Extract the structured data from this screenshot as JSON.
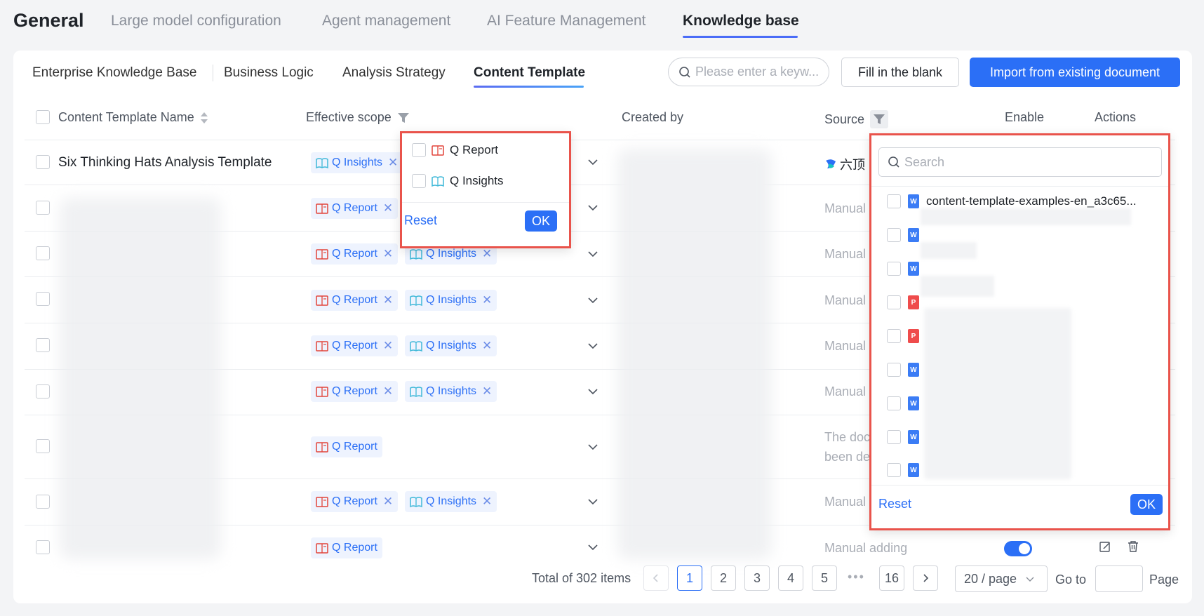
{
  "topnav": {
    "brand": "General",
    "tabs": [
      "Large model configuration",
      "Agent management",
      "AI Feature Management",
      "Knowledge base"
    ]
  },
  "subtabs": [
    "Enterprise Knowledge Base",
    "Business Logic",
    "Analysis Strategy",
    "Content Template"
  ],
  "toolbar": {
    "search_placeholder": "Please enter a keyw...",
    "fill_blank_label": "Fill in the blank",
    "import_label": "Import from existing document"
  },
  "table": {
    "headers": {
      "name": "Content Template Name",
      "scope": "Effective scope",
      "created_by": "Created by",
      "source": "Source",
      "enable": "Enable",
      "actions": "Actions"
    },
    "rows": [
      {
        "name": "Six Thinking Hats Analysis Template",
        "tags": [
          "Q Insights"
        ],
        "source": "六顶"
      },
      {
        "name": "",
        "tags": [
          "Q Report"
        ],
        "source": "Manual"
      },
      {
        "name": "",
        "tags": [
          "Q Report",
          "Q Insights"
        ],
        "source": "Manual"
      },
      {
        "name": "",
        "tags": [
          "Q Report",
          "Q Insights"
        ],
        "source": "Manual"
      },
      {
        "name": "",
        "tags": [
          "Q Report",
          "Q Insights"
        ],
        "source": "Manual"
      },
      {
        "name": "",
        "tags": [
          "Q Report",
          "Q Insights"
        ],
        "source": "Manual"
      },
      {
        "name": "",
        "tags": [
          "Q Report"
        ],
        "source": "The doc",
        "source2": "been de"
      },
      {
        "name": "",
        "tags": [
          "Q Report",
          "Q Insights"
        ],
        "source": "Manual"
      },
      {
        "name": "",
        "tags": [
          "Q Report"
        ],
        "source": "Manual adding"
      }
    ]
  },
  "scope_filter": {
    "options": [
      "Q Report",
      "Q Insights"
    ],
    "reset_label": "Reset",
    "ok_label": "OK"
  },
  "source_filter": {
    "search_placeholder": "Search",
    "first_file": "content-template-examples-en_a3c65...",
    "file_types": [
      "word",
      "word",
      "word",
      "pdf",
      "pdf",
      "word",
      "word",
      "word",
      "word"
    ],
    "reset_label": "Reset",
    "ok_label": "OK"
  },
  "pagination": {
    "total_text": "Total of 302 items",
    "pages": [
      "1",
      "2",
      "3",
      "4",
      "5"
    ],
    "ellipsis": "•••",
    "last_page": "16",
    "current": "1",
    "page_size": "20 / page",
    "goto_label": "Go to",
    "page_label": "Page"
  },
  "colors": {
    "accent": "#2b6ff6",
    "highlight_border": "#e9534b"
  }
}
